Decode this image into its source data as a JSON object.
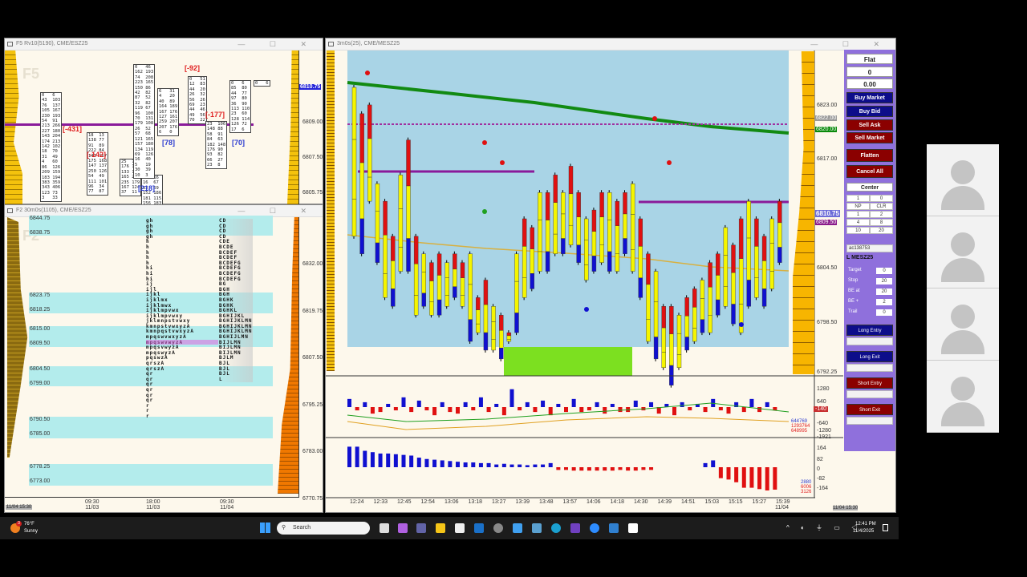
{
  "windows": {
    "tl_title": "F5 Rv10(5190), CME/ESZ25",
    "bl_title": "F2 30m0s(1105), CME/ESZ25",
    "main_title": "3m0s(25), CME/MESZ25",
    "tl_watermark": "F5",
    "bl_watermark": "F2"
  },
  "tl": {
    "prices": [
      "6810.75",
      "6809.00",
      "6807.50",
      "6805.75"
    ],
    "deltas": [
      {
        "t": "[-431]",
        "c": "#e02020"
      },
      {
        "t": "[-142]",
        "c": "#e02020"
      },
      {
        "t": "[218]",
        "c": "#2a3ad0"
      },
      {
        "t": "[78]",
        "c": "#2a3ad0"
      },
      {
        "t": "[-92]",
        "c": "#e02020"
      },
      {
        "t": "[-177]",
        "c": "#e02020"
      },
      {
        "t": "[70]",
        "c": "#2a3ad0"
      }
    ],
    "boxes": [
      "0   6\n43  103\n76  137\n105 167\n230 193\n54  91\n213 266\n227 180\n143 204\n174 213\n142 102\n18  70\n31  49\n4   60\n86  126\n209 159\n183 194\n383 359\n343 406\n123 73\n3   33",
      "18  13\n138 77\n91  89\n222 84\n143 167\n175 168\n147 137\n250 126\n54  49\n111 101\n96  34\n77  87",
      "25  70\n176 146\n133 155\n165 253\n235 179\n167 124\n37  11",
      "0   16\n16  67\n52  69\n152 186\n181 115\n156 183",
      "0   46\n162 193\n74  208\n223 165\n150 86\n42  82\n87  52\n32  82\n119 67\n96  100\n70  131\n179 108\n26  52\n57  68\n121 165\n157 180\n134 119\n69  126\n16  40\n5   19\n30  39\n10  3",
      "6   31\n4   20\n40  89\n164 189\n167 176\n127 161\n259 207\n207 176\n6   0",
      "0   51\n12  83\n44  20\n26  32\n56  26\n69  23\n44  46\n49  56\n70  22",
      "23  106\n148 88\n58  91\n84  63\n182 148\n176 90\n93  82\n66  27\n23  8",
      "0   6\n85  80\n44  77\n97  80\n36  90\n113 110\n23  60\n128 114\n126 72\n17  6",
      "0   6"
    ]
  },
  "bl": {
    "price_labels": [
      "6844.75",
      "6838.75",
      "6823.75",
      "6818.25",
      "6815.00",
      "6809.50",
      "6804.50",
      "6799.00",
      "6790.50",
      "6785.00",
      "6778.25",
      "6773.00"
    ],
    "axis_prices": [
      "6832.00",
      "6819.75",
      "6807.50",
      "6795.25",
      "6783.00",
      "6770.75"
    ],
    "time_labels": [
      {
        "t": "09:30",
        "d": "11/03"
      },
      {
        "t": "18:00",
        "d": "11/03"
      },
      {
        "t": "09:30",
        "d": "11/04"
      }
    ],
    "time_badge": "11/04 15:30",
    "tpo1": "gh\ngh\ngh\ngh\nh\nh\nh\nh\nh\nhi\nhi\nhi\nij\nijl\nijkl\nijklmx\nijklmwx\nijklmpvwx\nijklmpvwxy\njklmnpstvwxy\nkmnpstvwxyzA\nkmnpqstvwxyzA\nmpqswvwxyzA\nmpqswvwyzA\nmpqsvwyzA\nmpqswyzA\npqswzA\nqrszA\nqrszA\nqr\nqr\nqr\nqr\nqr\nqr\nr\nr\nr",
    "tpo2": "CD\nCD\nCD\nCD\nCDE\nBCDE\nBCDEF\nBCDEF\nBCDEFG\nBCDEFG\nBCDEFG\nBCDEFG\nBG\nBGH\nBGH\nBGHK\nBGHK\nBGHKL\nBGHIJKL\nBGHIJKLMN\nBGHIJKLMN\nBGHIJKLMN\nBGHIJLMN\nBIJLMN\nBIJLMN\nBIJLMN\nBJLM\nBJL\nBJL\nBJL\nL"
  },
  "main": {
    "price_labels": [
      "6823.00",
      "6817.00",
      "6804.50",
      "6798.50",
      "6792.25"
    ],
    "tags": [
      {
        "t": "6822.00",
        "c": "#888"
      },
      {
        "t": "6820.00",
        "c": "#0a8a0a"
      },
      {
        "t": "6810.75",
        "c": "#6c6cd8"
      },
      {
        "t": "6809.50",
        "c": "#8a1a8a"
      }
    ],
    "osc1_labels": [
      "1280",
      "640",
      "-640",
      "-1280",
      "-1921"
    ],
    "osc1_tag": "-140",
    "osc1_vals": [
      {
        "t": "644769",
        "c": "#2a3ad0"
      },
      {
        "t": "1293764",
        "c": "#e02020"
      },
      {
        "t": "648995",
        "c": "#e02020"
      }
    ],
    "osc2_labels": [
      "164",
      "82",
      "0",
      "-82",
      "-164"
    ],
    "osc2_vals": [
      {
        "t": "2880",
        "c": "#2a3ad0"
      },
      {
        "t": "6006",
        "c": "#e02020"
      },
      {
        "t": "3126",
        "c": "#e02020"
      }
    ],
    "time_labels": [
      "12:24",
      "12:33",
      "12:45",
      "12:54",
      "13:06",
      "13:18",
      "13:27",
      "13:39",
      "13:48",
      "13:57",
      "14:06",
      "14:18",
      "14:30",
      "14:39",
      "14:51",
      "15:03",
      "15:15",
      "15:27",
      "15:39"
    ],
    "date_label": "11/04",
    "time_badge": "11/04 15:30"
  },
  "chart_data": {
    "type": "bar",
    "title": "3m0s(25), CME/MESZ25",
    "ylim": [
      6792.25,
      6829
    ],
    "highs": [
      6825,
      6822,
      6823,
      6814,
      6812,
      6808,
      6815,
      6819,
      6808,
      6806,
      6805,
      6806,
      6805,
      6806,
      6805,
      6806,
      6801,
      6803,
      6800,
      6799,
      6797,
      6806,
      6810,
      6809,
      6813,
      6813,
      6815,
      6813,
      6816,
      6813,
      6810,
      6811,
      6813,
      6813,
      6812,
      6813,
      6814,
      6810,
      6806,
      6804,
      6800,
      6800,
      6799,
      6801,
      6802,
      6803,
      6805,
      6806,
      6809,
      6807,
      6810,
      6812,
      6810,
      6808,
      6810,
      6812
    ],
    "lows": [
      6808,
      6806,
      6812,
      6805,
      6801,
      6800,
      6804,
      6804,
      6799,
      6800,
      6799,
      6799,
      6800,
      6801,
      6800,
      6796,
      6797,
      6795,
      6795,
      6794,
      6796,
      6797,
      6801,
      6802,
      6804,
      6804,
      6806,
      6806,
      6807,
      6805,
      6803,
      6804,
      6805,
      6804,
      6804,
      6806,
      6804,
      6801,
      6796,
      6794,
      6793,
      6791,
      6793,
      6795,
      6796,
      6797,
      6797,
      6799,
      6800,
      6798,
      6797,
      6800,
      6801,
      6800,
      6802,
      6805
    ],
    "osc1": [
      500,
      -200,
      300,
      -400,
      -300,
      200,
      -200,
      600,
      -300,
      400,
      -200,
      -500,
      300,
      -300,
      -400,
      300,
      -200,
      600,
      -300,
      200,
      -500,
      1100,
      -200,
      300,
      -300,
      400,
      -500,
      200,
      -300,
      500,
      -300,
      -200,
      300,
      -400,
      200,
      -300,
      -300,
      400,
      -200,
      300,
      -400,
      200,
      -500,
      300,
      -200,
      200,
      -300,
      500,
      -200,
      -400,
      300,
      -300,
      500,
      -300,
      300,
      -200
    ],
    "osc2": [
      150,
      150,
      120,
      110,
      100,
      100,
      95,
      90,
      85,
      70,
      60,
      55,
      50,
      45,
      40,
      35,
      35,
      30,
      30,
      20,
      25,
      20,
      20,
      15,
      20,
      20,
      30,
      -20,
      -20,
      -25,
      -25,
      -25,
      -25,
      -25,
      -25,
      -20,
      -25,
      -25,
      -20,
      -20,
      0,
      0,
      0,
      0,
      0,
      0,
      30,
      50,
      -80,
      -90,
      -110,
      -150,
      -150,
      -160,
      -170,
      -164
    ]
  },
  "panel": {
    "status": "Flat",
    "qty": "0",
    "pnl": "0.00",
    "buy_market": "Buy Market",
    "buy_bid": "Buy Bid",
    "sell_ask": "Sell Ask",
    "sell_market": "Sell Market",
    "flatten": "Flatten",
    "cancel_all": "Cancel All",
    "center": "Center",
    "qty_input": "1",
    "qty_right": "0",
    "grid": [
      "NP",
      "CLR",
      "1",
      "2",
      "4",
      "8",
      "10",
      "20"
    ],
    "account": "ac138753",
    "instrument": "L MESZ25",
    "params": [
      {
        "l": "Target",
        "v": "0"
      },
      {
        "l": "Stop",
        "v": "20"
      },
      {
        "l": "BE at",
        "v": "20"
      },
      {
        "l": "BE +",
        "v": "2"
      },
      {
        "l": "Trail",
        "v": "0"
      }
    ],
    "long_entry": "Long Entry",
    "long_exit": "Long Exit",
    "short_entry": "Short Entry",
    "short_exit": "Short Exit"
  },
  "taskbar": {
    "temp": "76°F",
    "weather": "Sunny",
    "search": "Search",
    "time": "12:41 PM",
    "date": "11/4/2025",
    "badge": "3"
  }
}
